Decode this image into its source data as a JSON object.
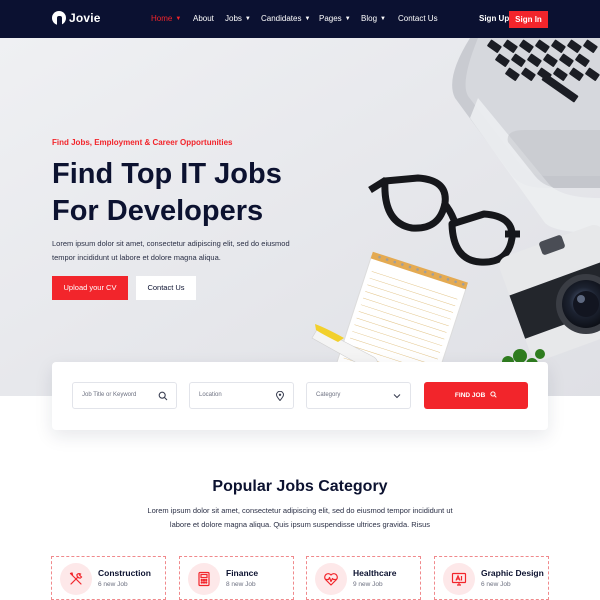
{
  "brand": {
    "name": "Jovie",
    "accent_color": "#f2252b",
    "nav_bg_color": "#0b1131"
  },
  "nav": {
    "items": [
      {
        "label": "Home",
        "has_dropdown": true,
        "active": true
      },
      {
        "label": "About",
        "has_dropdown": false,
        "active": false
      },
      {
        "label": "Jobs",
        "has_dropdown": true,
        "active": false
      },
      {
        "label": "Candidates",
        "has_dropdown": true,
        "active": false
      },
      {
        "label": "Pages",
        "has_dropdown": true,
        "active": false
      },
      {
        "label": "Blog",
        "has_dropdown": true,
        "active": false
      },
      {
        "label": "Contact Us",
        "has_dropdown": false,
        "active": false
      }
    ],
    "sign_up": "Sign Up",
    "sign_in": "Sign In"
  },
  "hero": {
    "eyebrow": "Find Jobs, Employment & Career Opportunities",
    "headline_line1": "Find Top IT Jobs",
    "headline_line2": "For Developers",
    "text": "Lorem ipsum dolor sit amet, consectetur adipiscing elit, sed do eiusmod tempor incididunt ut labore et dolore magna aliqua.",
    "upload_button": "Upload your CV",
    "contact_button": "Contact Us"
  },
  "search": {
    "keyword_placeholder": "Job Title or Keyword",
    "location_placeholder": "Location",
    "category_value": "Category",
    "find_button": "FIND JOB"
  },
  "popular": {
    "title": "Popular Jobs Category",
    "text": "Lorem ipsum dolor sit amet, consectetur adipiscing elit, sed do eiusmod tempor incididunt ut labore et dolore magna aliqua. Quis ipsum suspendisse ultrices gravida. Risus",
    "categories": [
      {
        "name": "Construction",
        "count": "6 new Job",
        "icon": "tools-icon"
      },
      {
        "name": "Finance",
        "count": "8 new Job",
        "icon": "calculator-icon"
      },
      {
        "name": "Healthcare",
        "count": "9 new Job",
        "icon": "heart-pulse-icon"
      },
      {
        "name": "Graphic Design",
        "count": "6 new Job",
        "icon": "design-monitor-icon"
      }
    ]
  }
}
